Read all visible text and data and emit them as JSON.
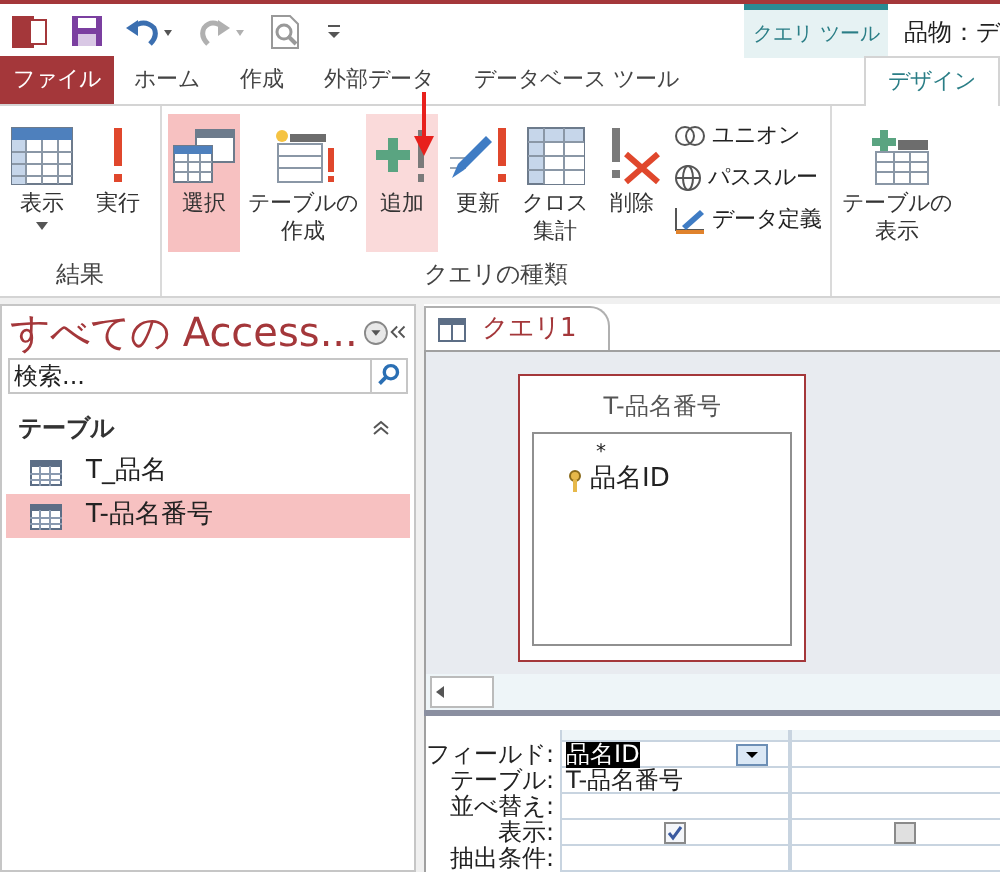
{
  "title_bar": {
    "context_tab": "クエリ ツール",
    "title": "品物：デ"
  },
  "menu_tabs": [
    {
      "label": "ファイル",
      "kind": "file",
      "selected": false
    },
    {
      "label": "ホーム",
      "kind": "tab",
      "selected": false
    },
    {
      "label": "作成",
      "kind": "tab",
      "selected": false
    },
    {
      "label": "外部データ",
      "kind": "tab",
      "selected": false
    },
    {
      "label": "データベース ツール",
      "kind": "tab",
      "selected": false
    },
    {
      "label": "デザイン",
      "kind": "tab",
      "selected": true
    }
  ],
  "ribbon_groups": [
    {
      "label": "結果",
      "buttons": [
        {
          "kind": "large",
          "lines": [
            "表示"
          ],
          "dropdown": true,
          "selected": false,
          "hovered": false
        },
        {
          "kind": "large",
          "lines": [
            "実行"
          ],
          "dropdown": false,
          "selected": false,
          "hovered": false
        }
      ]
    },
    {
      "label": "クエリの種類",
      "buttons": [
        {
          "kind": "large",
          "lines": [
            "選択"
          ],
          "dropdown": false,
          "selected": true,
          "hovered": false
        },
        {
          "kind": "large",
          "lines": [
            "テーブルの",
            "作成"
          ],
          "dropdown": false,
          "selected": false,
          "hovered": false
        },
        {
          "kind": "large",
          "lines": [
            "追加"
          ],
          "dropdown": false,
          "selected": false,
          "hovered": true
        },
        {
          "kind": "large",
          "lines": [
            "更新"
          ],
          "dropdown": false,
          "selected": false,
          "hovered": false
        },
        {
          "kind": "large",
          "lines": [
            "クロス",
            "集計"
          ],
          "dropdown": false,
          "selected": false,
          "hovered": false
        },
        {
          "kind": "large",
          "lines": [
            "削除"
          ],
          "dropdown": false,
          "selected": false,
          "hovered": false
        },
        {
          "kind": "small",
          "lines": [
            "ユニオン"
          ],
          "selected": false,
          "hovered": false
        },
        {
          "kind": "small",
          "lines": [
            "パススルー"
          ],
          "selected": false,
          "hovered": false
        },
        {
          "kind": "small",
          "lines": [
            "データ定義"
          ],
          "selected": false,
          "hovered": false
        }
      ]
    },
    {
      "buttons": [
        {
          "kind": "large",
          "lines": [
            "テーブルの",
            "表示"
          ],
          "dropdown": false,
          "selected": false,
          "hovered": false
        }
      ]
    }
  ],
  "nav_pane": {
    "title": "すべての Access...",
    "search": {
      "placeholder": "検索..."
    },
    "section": {
      "label": "テーブル",
      "expanded": true
    },
    "items": [
      {
        "label": "T_品名",
        "selected": false
      },
      {
        "label": "T-品名番号",
        "selected": true
      }
    ]
  },
  "document_tabs": [
    {
      "label": "クエリ1",
      "selected": true
    }
  ],
  "field_list": {
    "title": "T-品名番号",
    "fields": [
      {
        "label": "*",
        "primary_key": false
      },
      {
        "label": "品名ID",
        "primary_key": true
      }
    ]
  },
  "design_grid": {
    "row_labels": [
      "フィールド:",
      "テーブル:",
      "並べ替え:",
      "表示:",
      "抽出条件:"
    ],
    "columns": [
      {
        "field": "品名ID",
        "field_selected": true,
        "table": "T-品名番号",
        "show": true,
        "active": true
      },
      {
        "show": false,
        "active": false
      }
    ]
  }
}
